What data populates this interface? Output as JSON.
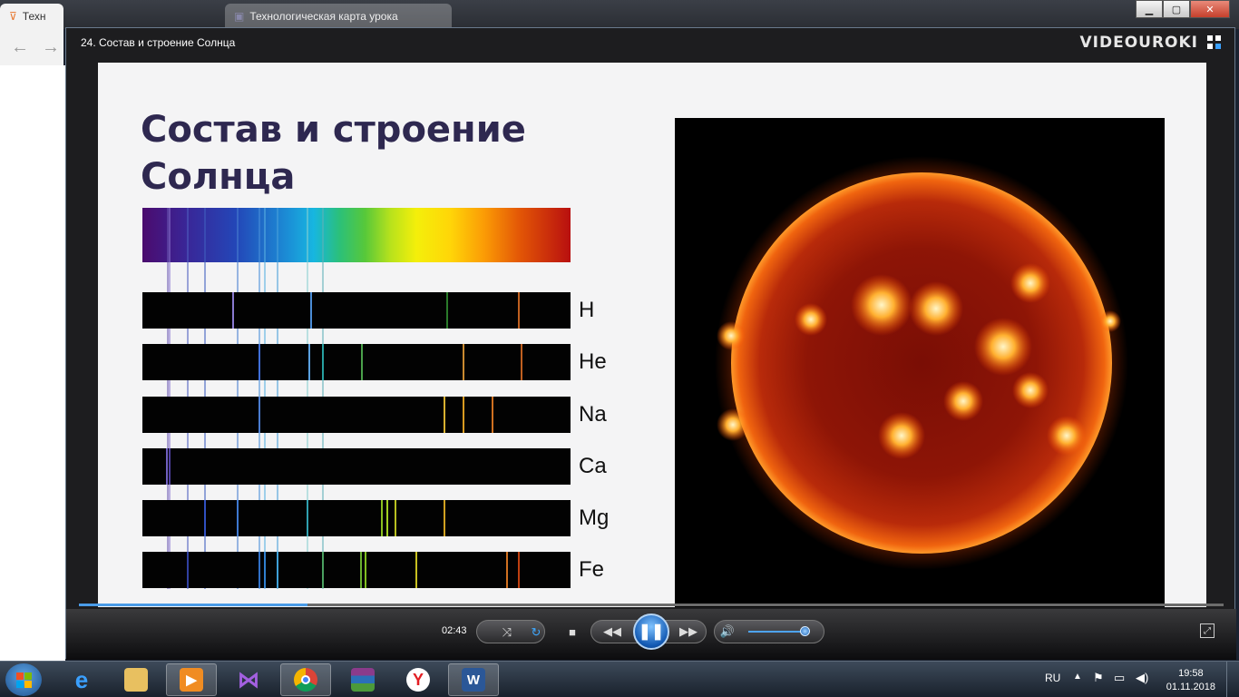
{
  "browser": {
    "tab1_label": "Техн",
    "tab2_label": "Технологическая карта урока"
  },
  "player": {
    "title": "24. Состав и строение Солнца",
    "logo": "VIDEOUROKI",
    "current_time": "02:43",
    "progress_fraction": 0.2,
    "volume_fraction": 0.95
  },
  "slide": {
    "title": "Состав и строение Солнца",
    "elements": [
      "H",
      "He",
      "Na",
      "Ca",
      "Mg",
      "Fe"
    ]
  },
  "taskbar": {
    "language": "RU",
    "time": "19:58",
    "date": "01.11.2018",
    "apps": [
      "internet-explorer-icon",
      "file-explorer-icon",
      "video-player-icon",
      "visual-studio-icon",
      "chrome-icon",
      "winrar-icon",
      "yandex-icon",
      "word-icon"
    ]
  }
}
